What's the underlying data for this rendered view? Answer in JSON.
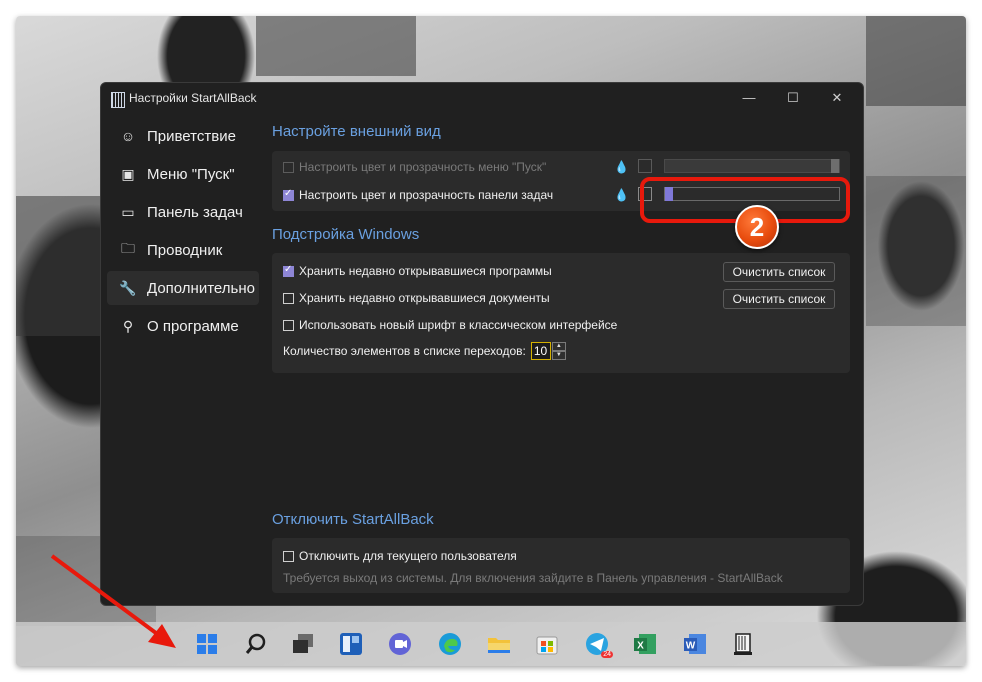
{
  "window": {
    "title": "Настройки StartAllBack",
    "controls": {
      "minimize": "—",
      "maximize": "☐",
      "close": "✕"
    }
  },
  "sidebar": {
    "items": [
      {
        "label": "Приветствие",
        "icon": "smile-icon",
        "glyph": "☺",
        "active": false
      },
      {
        "label": "Меню \"Пуск\"",
        "icon": "start-menu-icon",
        "glyph": "▣",
        "active": false
      },
      {
        "label": "Панель задач",
        "icon": "taskbar-icon",
        "glyph": "▭",
        "active": false
      },
      {
        "label": "Проводник",
        "icon": "folder-icon",
        "glyph": "🗀",
        "active": false
      },
      {
        "label": "Дополнительно",
        "icon": "wrench-icon",
        "glyph": "🔧",
        "active": true
      },
      {
        "label": "О программе",
        "icon": "about-icon",
        "glyph": "⚲",
        "active": false
      }
    ]
  },
  "appearance": {
    "title": "Настройте внешний вид",
    "start_menu_color": {
      "label": "Настроить цвет и прозрачность меню \"Пуск\"",
      "checked": false,
      "enabled": false,
      "transparency": 1.0
    },
    "taskbar_color": {
      "label": "Настроить цвет и прозрачность панели задач",
      "checked": true,
      "enabled": true,
      "transparency": 0.0
    }
  },
  "windows_tweaks": {
    "title": "Подстройка Windows",
    "recent_programs": {
      "label": "Хранить недавно открывавшиеся программы",
      "checked": true,
      "button": "Очистить список"
    },
    "recent_documents": {
      "label": "Хранить недавно открывавшиеся документы",
      "checked": false,
      "button": "Очистить список"
    },
    "new_font": {
      "label": "Использовать новый шрифт в классическом интерфейсе",
      "checked": false
    },
    "jump_list": {
      "label": "Количество элементов в списке переходов:",
      "value": "10",
      "up": "▲",
      "down": "▼"
    }
  },
  "disable": {
    "title": "Отключить StartAllBack",
    "current_user": {
      "label": "Отключить для текущего пользователя",
      "checked": false
    },
    "hint": "Требуется выход из системы. Для включения зайдите в Панель управления - StartAllBack"
  },
  "annotation": {
    "step_number": "2"
  },
  "taskbar": {
    "icons": [
      {
        "name": "windows-start-icon",
        "color": "#2b7de9"
      },
      {
        "name": "search-icon",
        "color": "#1f1f1f"
      },
      {
        "name": "task-view-icon",
        "color": "#2f2f2f"
      },
      {
        "name": "widgets-icon",
        "color": "#1e5fb8"
      },
      {
        "name": "teams-chat-icon",
        "color": "#6264d6"
      },
      {
        "name": "edge-icon",
        "color": "#1a9bd8"
      },
      {
        "name": "file-explorer-icon",
        "color": "#f3c23a"
      },
      {
        "name": "microsoft-store-icon",
        "color": "#f0f0f0"
      },
      {
        "name": "telegram-icon",
        "color": "#2aa3e0",
        "badge": "24"
      },
      {
        "name": "excel-icon",
        "color": "#1f7a45"
      },
      {
        "name": "word-icon",
        "color": "#2b5cb8"
      },
      {
        "name": "startallback-icon",
        "color": "#e8e8e8"
      }
    ]
  }
}
